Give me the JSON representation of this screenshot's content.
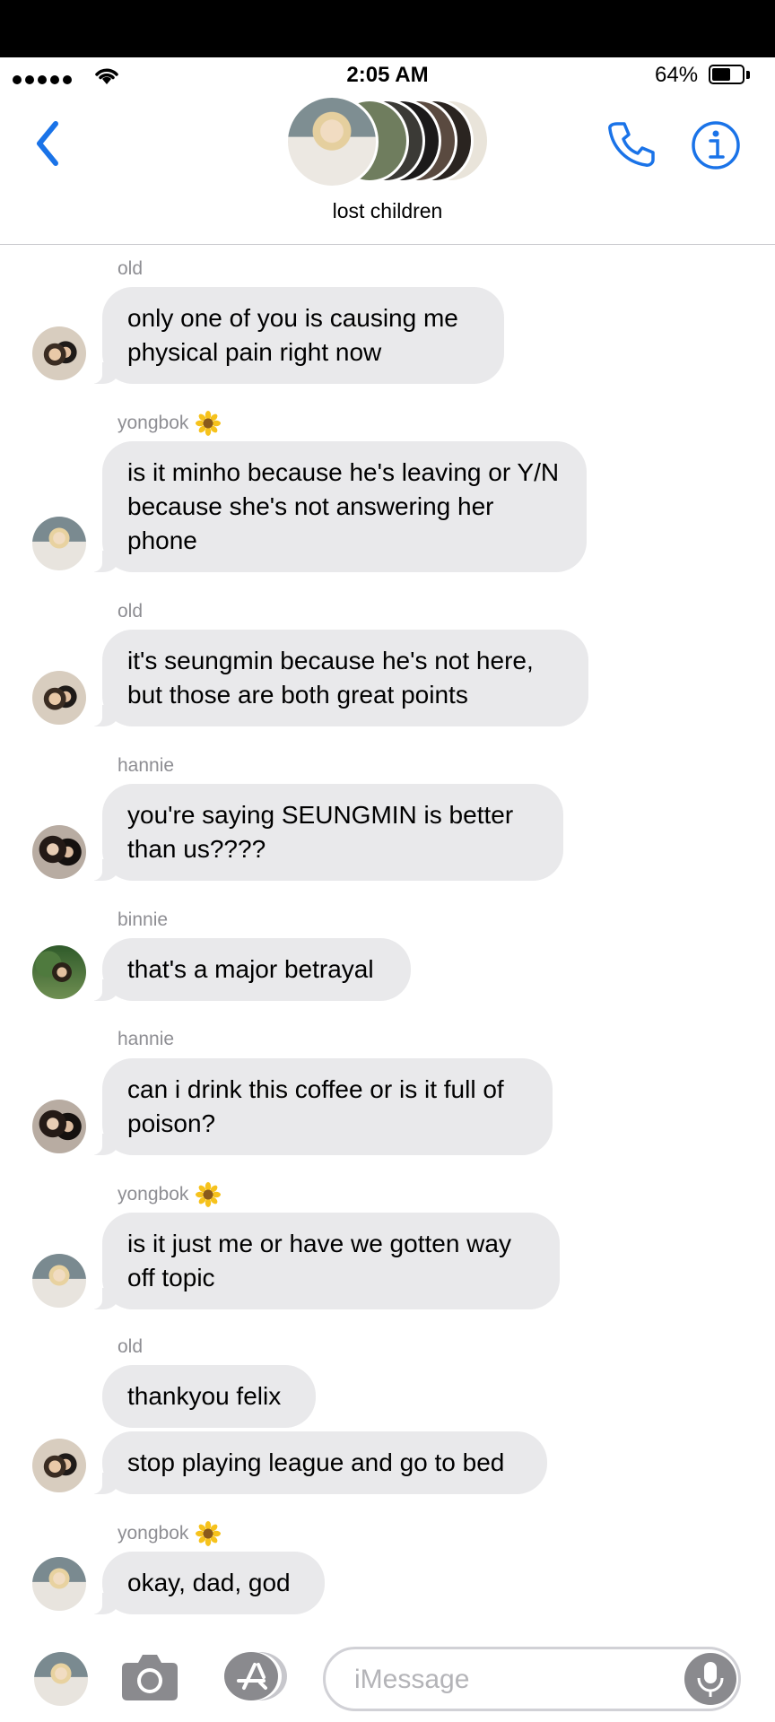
{
  "status": {
    "time": "2:05 AM",
    "battery_pct": "64%",
    "battery_level": 0.64
  },
  "header": {
    "group_name": "lost children"
  },
  "messages": [
    {
      "sender": "old",
      "flower": false,
      "avatar": "old",
      "text": "only one of you is causing me physical pain right now"
    },
    {
      "sender": "yongbok",
      "flower": true,
      "avatar": "yong",
      "text": "is it minho because he's leaving or Y/N because she's not answering her phone"
    },
    {
      "sender": "old",
      "flower": false,
      "avatar": "old",
      "text": "it's seungmin because he's not here, but those are both great points"
    },
    {
      "sender": "hannie",
      "flower": false,
      "avatar": "han",
      "text": "you're saying SEUNGMIN is better than us????"
    },
    {
      "sender": "binnie",
      "flower": false,
      "avatar": "bin",
      "text": "that's a major betrayal"
    },
    {
      "sender": "hannie",
      "flower": false,
      "avatar": "han",
      "text": "can i drink this coffee or is it full of poison?"
    },
    {
      "sender": "yongbok",
      "flower": true,
      "avatar": "yong",
      "text": "is it just me or have we gotten way off topic"
    },
    {
      "sender": "old",
      "flower": false,
      "avatar": "old",
      "text": "thankyou felix"
    },
    {
      "sender": "",
      "flower": false,
      "avatar": "old",
      "text": "stop playing league and go to bed"
    },
    {
      "sender": "yongbok",
      "flower": true,
      "avatar": "yong",
      "text": "okay, dad, god"
    }
  ],
  "composer": {
    "placeholder": "iMessage"
  },
  "icons": {
    "back": "chevron-left-icon",
    "call": "phone-icon",
    "info": "info-icon",
    "camera": "camera-icon",
    "apps": "app-store-icon",
    "mic": "microphone-icon",
    "flower": "sunflower-emoji"
  },
  "colors": {
    "accent": "#1a73e8",
    "bubble": "#e9e9eb",
    "sender_label": "#8e8e93"
  }
}
